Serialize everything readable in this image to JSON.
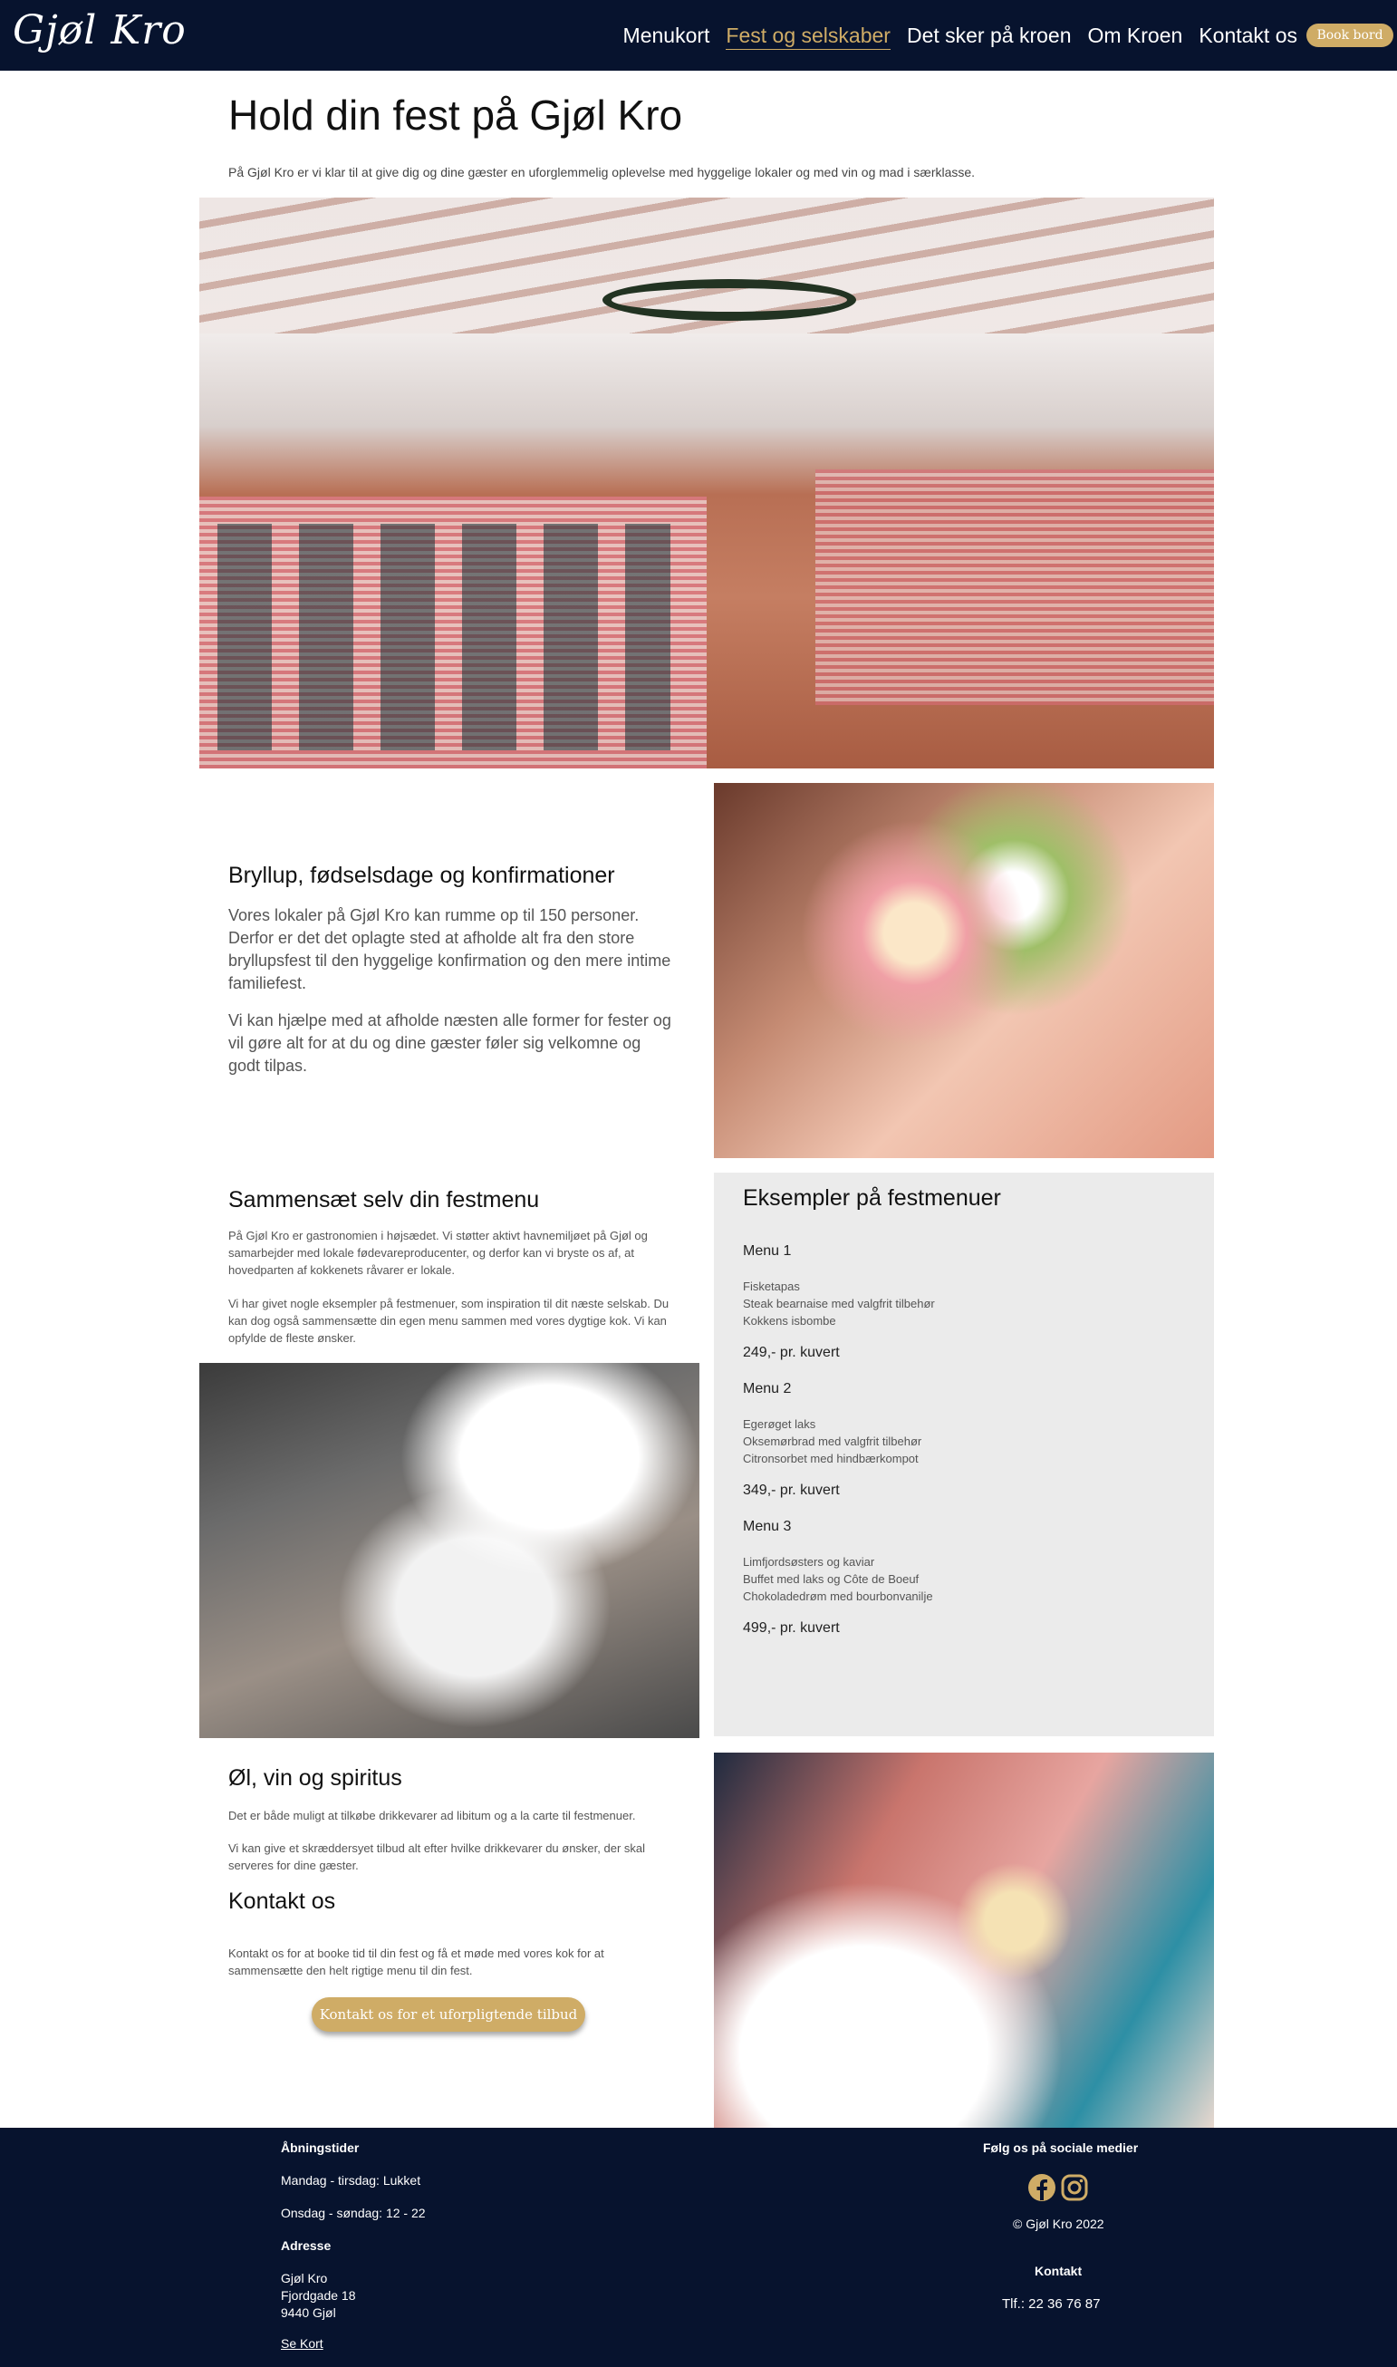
{
  "nav": {
    "logo": "Gjøl Kro",
    "items": [
      {
        "label": "Menukort",
        "active": false
      },
      {
        "label": "Fest og selskaber",
        "active": true
      },
      {
        "label": "Det sker på kroen",
        "active": false
      },
      {
        "label": "Om Kroen",
        "active": false
      },
      {
        "label": "Kontakt os",
        "active": false
      }
    ],
    "book_label": "Book bord"
  },
  "hero": {
    "title": "Hold din fest på Gjøl Kro",
    "intro": "På Gjøl Kro er vi klar til at give dig og dine gæster en uforglemmelig oplevelse med hyggelige lokaler og med vin og mad i særklasse."
  },
  "wedding": {
    "title": "Bryllup, fødselsdage og konfirmationer",
    "p1": "Vores lokaler på Gjøl Kro kan rumme op til 150 personer. Derfor er det det oplagte sted at afholde alt fra den store bryllupsfest til den hyggelige konfirmation og den mere intime familiefest.",
    "p2": "Vi kan hjælpe med at afholde næsten alle former for fester og vil gøre alt for at du og dine gæster føler sig velkomne og godt tilpas."
  },
  "custom_menu": {
    "title": "Sammensæt selv din festmenu",
    "p1": "På Gjøl Kro er gastronomien i højsædet. Vi støtter aktivt havnemiljøet på Gjøl og samarbejder med lokale fødevareproducenter, og derfor kan vi bryste os af, at hovedparten af kokkenets råvarer er lokale.",
    "p2": "Vi har givet nogle eksempler på festmenuer, som inspiration til dit næste selskab. Du kan dog også sammensætte din egen menu sammen med vores dygtige kok. Vi kan opfylde de fleste ønsker."
  },
  "examples": {
    "title": "Eksempler på festmenuer",
    "menus": [
      {
        "name": "Menu 1",
        "dishes": [
          "Fisketapas",
          "Steak bearnaise med valgfrit tilbehør",
          "Kokkens isbombe"
        ],
        "price": "249,- pr. kuvert"
      },
      {
        "name": "Menu 2",
        "dishes": [
          "Egerøget laks",
          "Oksemørbrad med valgfrit tilbehør",
          "Citronsorbet med hindbærkompot"
        ],
        "price": "349,- pr. kuvert"
      },
      {
        "name": "Menu 3",
        "dishes": [
          "Limfjordsøsters og kaviar",
          "Buffet med laks og Côte de Boeuf",
          "Chokoladedrøm med bourbonvanilje"
        ],
        "price": "499,- pr. kuvert"
      }
    ]
  },
  "drinks": {
    "title": "Øl, vin og spiritus",
    "p1": "Det er både muligt at tilkøbe drikkevarer ad libitum og a la carte til festmenuer.",
    "p2": "Vi kan give et skræddersyet tilbud alt efter hvilke drikkevarer du ønsker, der skal serveres for dine gæster."
  },
  "contact": {
    "title": "Kontakt os",
    "p1": "Kontakt os for at booke tid til din fest og få et møde med vores kok for at sammensætte den helt rigtige menu til din fest.",
    "cta_label": "Kontakt os for et uforpligtende tilbud"
  },
  "footer": {
    "hours_title": "Åbningstider",
    "hours": [
      "Mandag - tirsdag: Lukket",
      "Onsdag - søndag: 12 - 22"
    ],
    "address_title": "Adresse",
    "address": [
      "Gjøl Kro",
      "Fjordgade 18",
      "9440 Gjøl"
    ],
    "map_link": "Se Kort",
    "social_title": "Følg os på sociale medier",
    "copyright": "© Gjøl Kro 2022",
    "contact_title": "Kontakt",
    "phone": "Tlf.: 22 36 76 87"
  },
  "colors": {
    "navy": "#07132e",
    "gold": "#cfac66",
    "panel": "#ebebeb"
  }
}
